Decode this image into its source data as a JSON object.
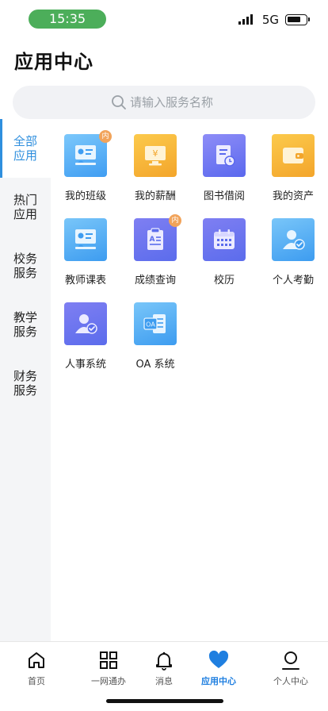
{
  "status": {
    "time": "15:35",
    "network": "5G"
  },
  "page": {
    "title": "应用中心"
  },
  "search": {
    "placeholder": "请输入服务名称"
  },
  "categories": [
    {
      "label": "全部应用",
      "active": true
    },
    {
      "label": "热门应用",
      "active": false
    },
    {
      "label": "校务服务",
      "active": false
    },
    {
      "label": "教学服务",
      "active": false
    },
    {
      "label": "财务服务",
      "active": false
    }
  ],
  "apps": [
    {
      "label": "我的班级",
      "icon": "classroom-board-icon",
      "badge": "内"
    },
    {
      "label": "我的薪酬",
      "icon": "salary-monitor-icon",
      "badge": ""
    },
    {
      "label": "图书借阅",
      "icon": "book-clock-icon",
      "badge": ""
    },
    {
      "label": "我的资产",
      "icon": "wallet-icon",
      "badge": ""
    },
    {
      "label": "教师课表",
      "icon": "teacher-board-icon",
      "badge": ""
    },
    {
      "label": "成绩查询",
      "icon": "clipboard-grade-icon",
      "badge": "内"
    },
    {
      "label": "校历",
      "icon": "calendar-icon",
      "badge": ""
    },
    {
      "label": "个人考勤",
      "icon": "user-check-icon",
      "badge": ""
    },
    {
      "label": "人事系统",
      "icon": "personnel-icon",
      "badge": ""
    },
    {
      "label": "OA 系统",
      "icon": "oa-document-icon",
      "badge": "",
      "icon_text": "OA"
    }
  ],
  "tabs": [
    {
      "label": "首页",
      "icon": "home-icon"
    },
    {
      "label": "一网通办",
      "icon": "grid-icon"
    },
    {
      "label": "消息",
      "icon": "bell-icon"
    },
    {
      "label": "应用中心",
      "icon": "heart-icon",
      "active": true
    },
    {
      "label": "个人中心",
      "icon": "person-icon"
    }
  ],
  "colors": {
    "accent": "#2f8fde",
    "time_pill": "#4cae5a",
    "badge": "#f1a35a"
  }
}
